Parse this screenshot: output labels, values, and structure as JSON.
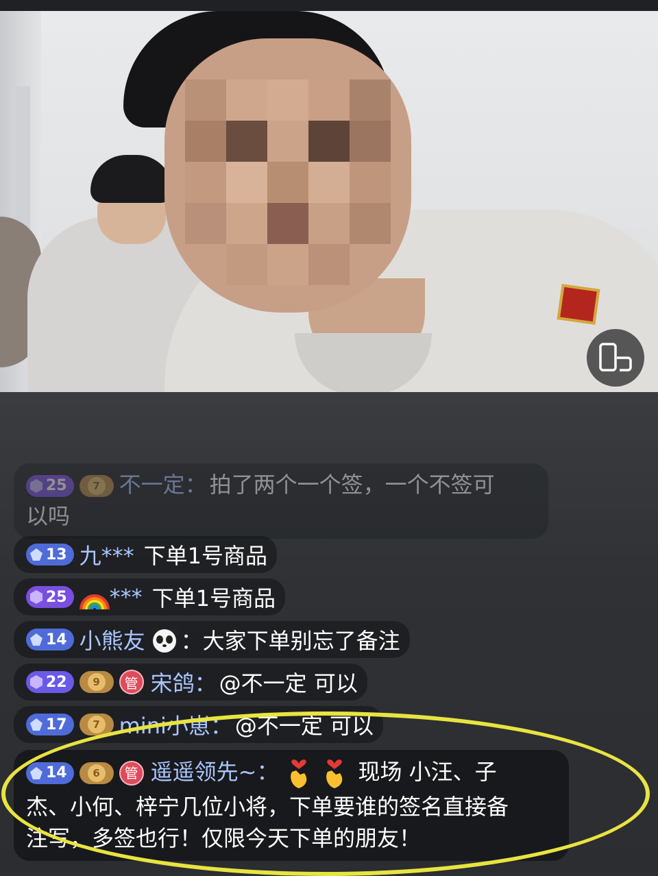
{
  "live_video": {
    "toggle_icon": "screen-orientation-icon"
  },
  "chat": {
    "messages": [
      {
        "level": "25",
        "fan_level": "7",
        "user": "不一定：",
        "text": "拍了两个一个签，一个不签可",
        "text2": "以吗"
      },
      {
        "level": "13",
        "user": "九***",
        "text": "下单1号商品"
      },
      {
        "level": "25",
        "user": "***",
        "text": "下单1号商品",
        "user_emoji": "rainbow-emoji"
      },
      {
        "level": "14",
        "user": "小熊友",
        "sep": "：",
        "text": "大家下单别忘了备注",
        "user_emoji": "panda-emoji"
      },
      {
        "level": "22",
        "fan_level": "9",
        "admin": "管",
        "user": "宋鸽：",
        "text": "@不一定 可以"
      },
      {
        "level": "17",
        "fan_level": "7",
        "user": "mini小崽：",
        "text": "@不一定 可以"
      },
      {
        "level": "14",
        "fan_level": "6",
        "admin": "管",
        "user": "遥遥领先~：",
        "text": "现场 小汪、子",
        "text2": "杰、小何、梓宁几位小将，下单要谁的签名直接备",
        "text3": "注写，多签也行！仅限今天下单的朋友！",
        "emoji": "finger-heart-emoji"
      }
    ]
  },
  "colors": {
    "highlight": "#e8e440",
    "username": "#a9c6ff",
    "level_blue": "#4f6bd8",
    "level_purple": "#7a4fe0",
    "admin_red": "#e04a5a"
  }
}
